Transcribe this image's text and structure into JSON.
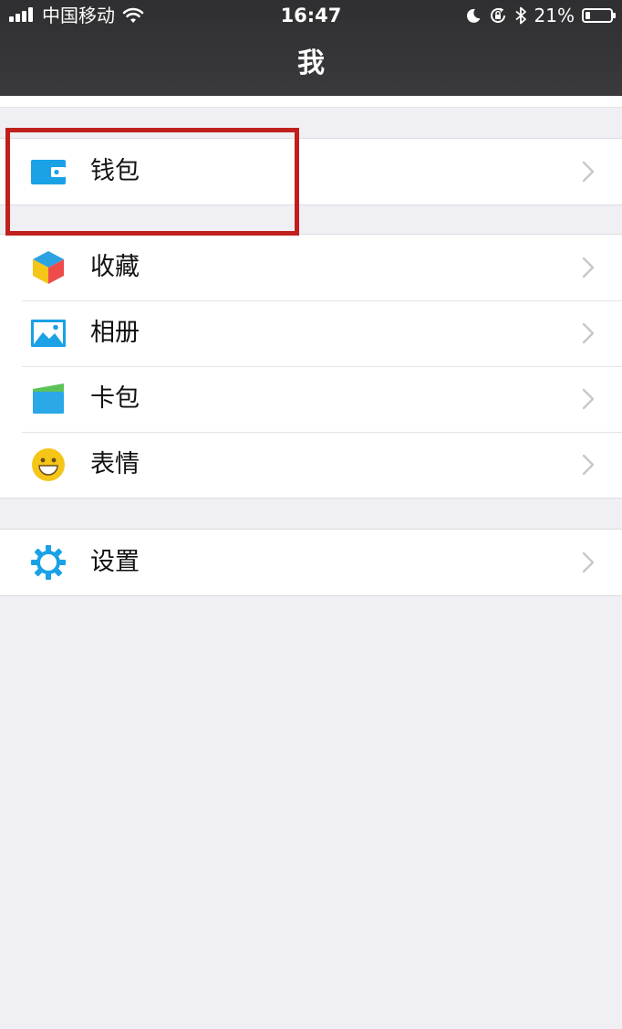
{
  "status_bar": {
    "carrier": "中国移动",
    "time": "16:47",
    "battery_percent": "21%",
    "battery_level": 0.21,
    "icons": [
      "signal-icon",
      "wifi-icon",
      "moon-icon",
      "rotation-lock-icon",
      "bluetooth-icon",
      "battery-icon"
    ]
  },
  "nav": {
    "title": "我"
  },
  "groups": [
    {
      "items": [
        {
          "label": "钱包",
          "icon": "wallet-icon"
        }
      ]
    },
    {
      "items": [
        {
          "label": "收藏",
          "icon": "favorites-cube-icon"
        },
        {
          "label": "相册",
          "icon": "album-picture-icon"
        },
        {
          "label": "卡包",
          "icon": "card-wallet-icon"
        },
        {
          "label": "表情",
          "icon": "smiley-icon"
        }
      ]
    },
    {
      "items": [
        {
          "label": "设置",
          "icon": "settings-gear-icon"
        }
      ]
    }
  ],
  "colors": {
    "nav_bg": "#333335",
    "page_bg": "#efeff4",
    "highlight_border": "#c0201c",
    "icon_blue": "#1aa1e6",
    "smiley_yellow": "#f5c518"
  }
}
